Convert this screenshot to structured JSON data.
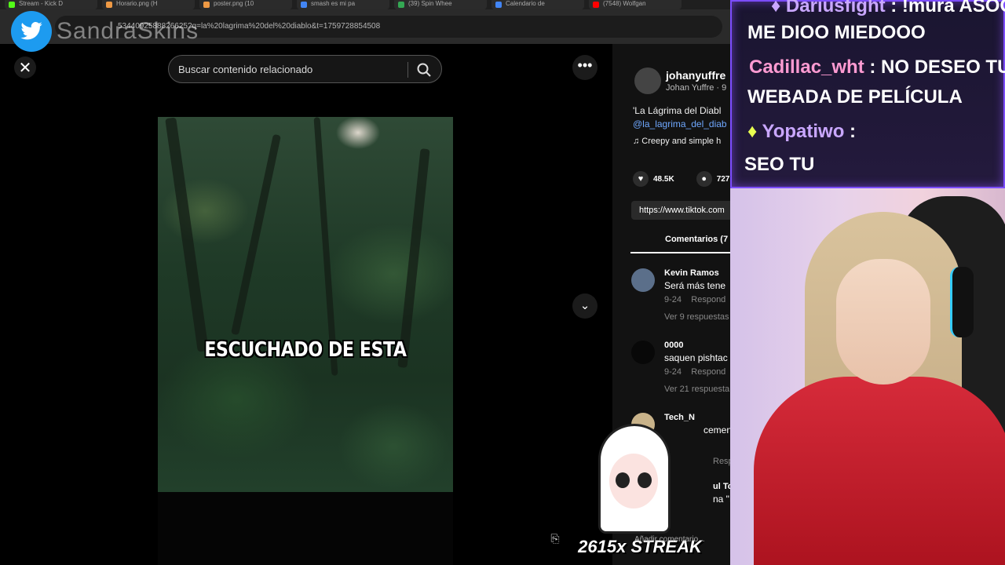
{
  "browser": {
    "tabs": [
      {
        "label": "Stream - Kick D",
        "color": "#53fc18"
      },
      {
        "label": "Horario.png (H",
        "color": "#e94"
      },
      {
        "label": "poster.png (10",
        "color": "#e94"
      },
      {
        "label": "smash es mi pa",
        "color": "#4285f4"
      },
      {
        "label": "(39) Spin Whee",
        "color": "#34a853"
      },
      {
        "label": "Calendario de",
        "color": "#4285f4"
      },
      {
        "label": "(7548) Wolfgan",
        "color": "#ff0000"
      }
    ],
    "url": "5344092588826625?q=la%20lagrima%20del%20diablo&t=1759728854508"
  },
  "overlay": {
    "twitter_handle": "SandraSkins"
  },
  "tiktok": {
    "search_placeholder": "Buscar contenido relacionado",
    "video_caption": "ESCUCHADO DE ESTA",
    "author_username": "johanyuffre",
    "author_fullname": "Johan Yuffre · 9",
    "description": "'La Lágrima del Diabl",
    "hashtag": "@la_lagrima_del_diab",
    "music": "♫  Creepy and simple h",
    "likes": "48.5K",
    "comments_count": "727",
    "link": "https://www.tiktok.com",
    "comments_tab": "Comentarios (7",
    "comments": [
      {
        "user": "Kevin Ramos",
        "text": "Será más tene",
        "date": "9-24",
        "reply": "Respond",
        "replies": "Ver 9 respuestas"
      },
      {
        "user": "0000",
        "text": "saquen pishtac",
        "date": "9-24",
        "reply": "Respond",
        "replies": "Ver 21 respuesta"
      },
      {
        "user": "Tech_N",
        "text": "cementer",
        "date": "",
        "reply": "Resp",
        "replies": ""
      },
      {
        "user": "ul Torres",
        "text": "na \"Elec",
        "date": "",
        "reply": "",
        "replies": ""
      }
    ],
    "add_comment": "Añadir comentario..."
  },
  "chat": {
    "messages": [
      {
        "user": "Dariusfight",
        "text": "ME DIOO MIEDOOO",
        "prefix": ": !mura ASOO"
      },
      {
        "user": "Cadillac_wht",
        "text": "WEBADA DE PELÍCULA",
        "prefix": ": NO DESEO TU"
      },
      {
        "user": "Yopatiwo",
        "text": "SEO TU",
        "prefix": ":"
      }
    ]
  },
  "streak": {
    "text": "2615x STREAK"
  },
  "colors": {
    "chat_border": "#7c4dff",
    "hoodie": "#c41e2c",
    "tiktok_link": "#6fa8ff"
  }
}
